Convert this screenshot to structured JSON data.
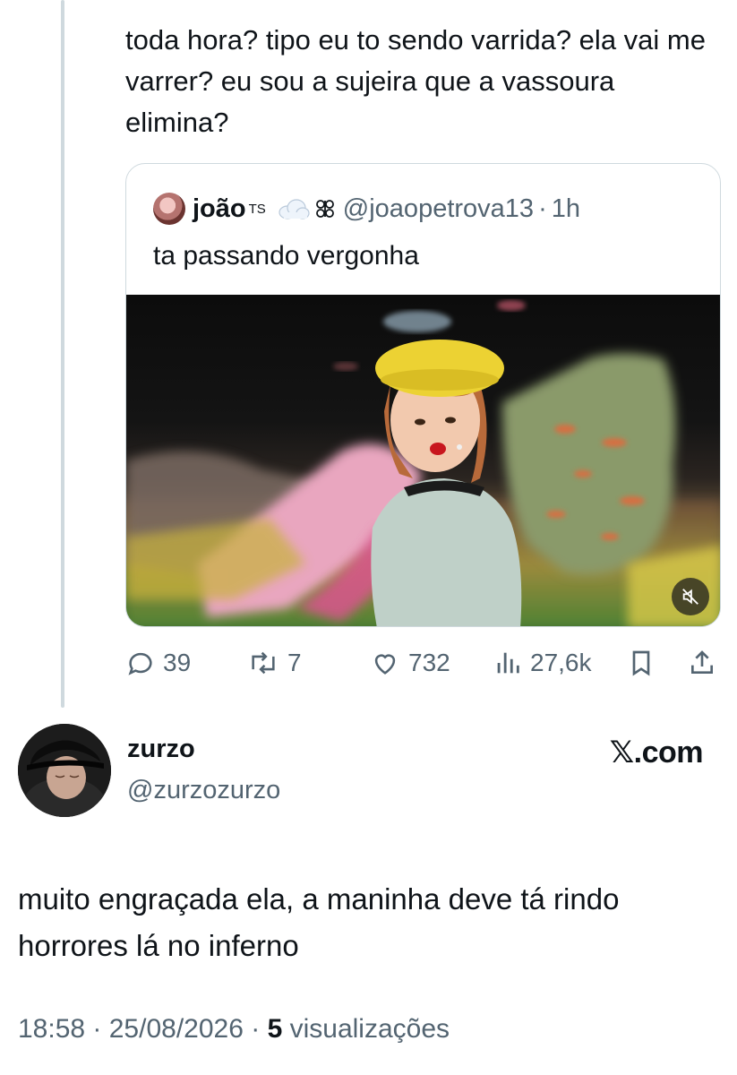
{
  "previous_tweet": {
    "text": "toda hora? tipo eu to sendo varrida? ela vai me varrer? eu sou a sujeira que a vassoura elimina?"
  },
  "quoted_tweet": {
    "display_name": "joão",
    "name_superscript": "TS",
    "handle": "@joaopetrova13",
    "separator": "·",
    "time": "1h",
    "text": "ta passando vergonha"
  },
  "actions": {
    "replies": "39",
    "retweets": "7",
    "likes": "732",
    "views": "27,6k"
  },
  "main_tweet": {
    "display_name": "zurzo",
    "handle": "@zurzozurzo",
    "site_badge": "𝕏.com",
    "text": "muito engraçada ela, a maninha deve tá rindo horrores lá no inferno",
    "time": "18:58",
    "date": "25/08/2026",
    "views_count": "5",
    "views_label": "visualizações"
  },
  "colors": {
    "text": "#0f1419",
    "secondary": "#536471",
    "border": "#cfd9de"
  }
}
